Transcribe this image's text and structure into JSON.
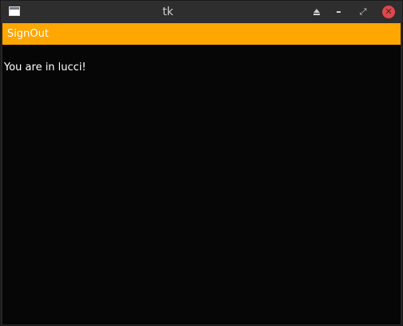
{
  "window": {
    "title": "tk"
  },
  "titlebar": {
    "icons": [
      "app-icon",
      "keep-above-icon",
      "minimize-icon",
      "maximize-icon",
      "close-icon"
    ],
    "close_glyph": "✕",
    "max_glyph": "⤢"
  },
  "main": {
    "signout_label": "SignOut",
    "message": "You are in lucci!"
  },
  "colors": {
    "accent": "#ffa600",
    "background": "#060606",
    "close": "#e0464b"
  }
}
